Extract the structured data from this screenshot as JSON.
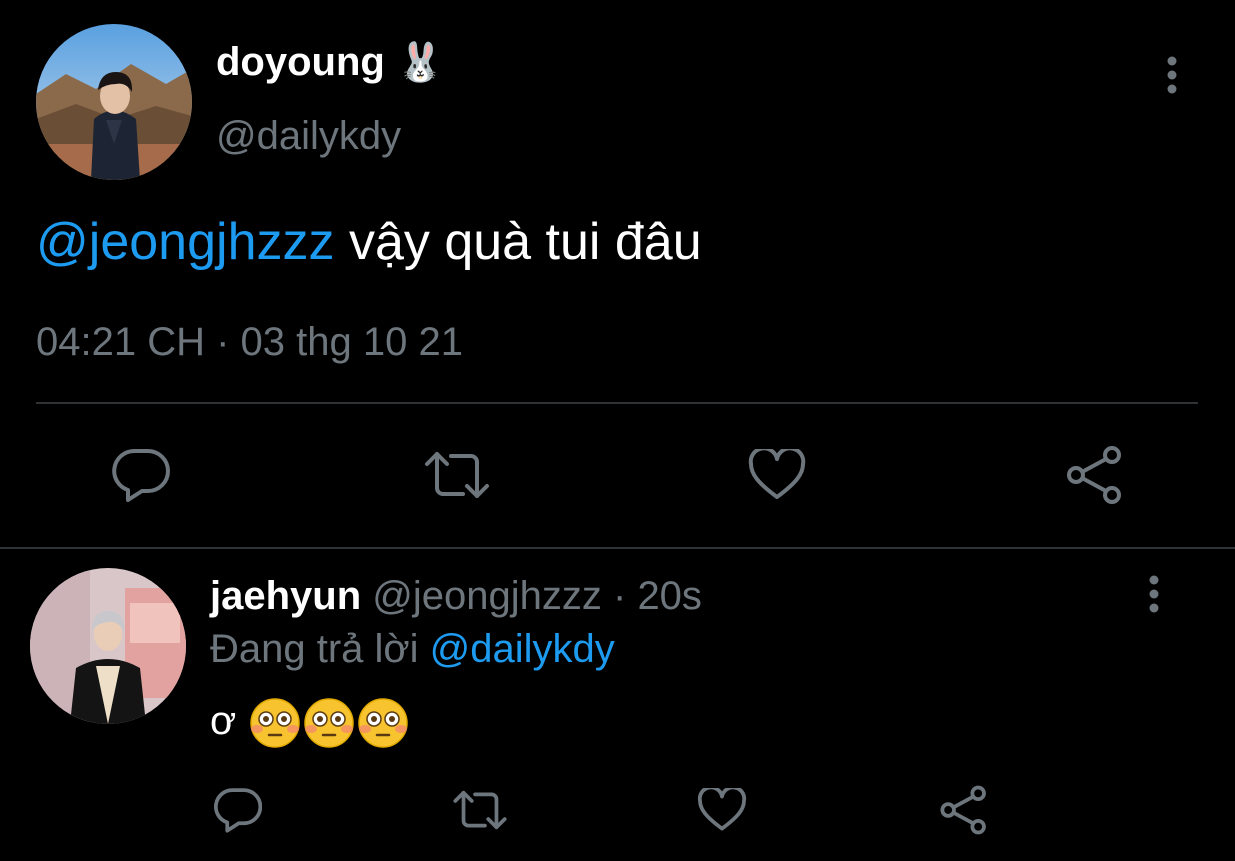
{
  "main_tweet": {
    "display_name": "doyoung",
    "name_emoji": "🐰",
    "handle": "@dailykdy",
    "mention": "@jeongjhzzz",
    "text": " vậy quà tui đâu",
    "timestamp": "04:21 CH · 03 thg 10 21",
    "actions": [
      "reply-icon",
      "retweet-icon",
      "like-icon",
      "share-icon"
    ]
  },
  "reply": {
    "display_name": "jaehyun",
    "handle": "@jeongjhzzz",
    "separator": " · ",
    "time": "20s",
    "replying_prefix": "Đang trả lời ",
    "replying_to": "@dailykdy",
    "text": "ơ",
    "emojis": [
      "flushed-face",
      "flushed-face",
      "flushed-face"
    ],
    "actions": [
      "reply-icon",
      "retweet-icon",
      "like-icon",
      "share-icon"
    ]
  },
  "colors": {
    "background": "#000000",
    "text": "#ffffff",
    "secondary": "#6e767d",
    "accent": "#1d9bf0",
    "divider": "#2f3336"
  }
}
